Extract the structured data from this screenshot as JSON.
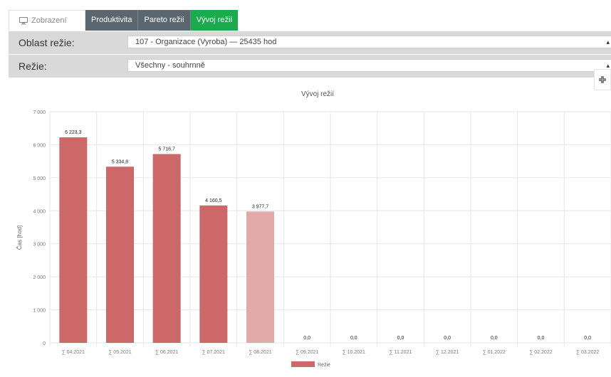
{
  "tabs": [
    {
      "label": "Zobrazení",
      "icon": "monitor-icon"
    },
    {
      "label": "Produktivita"
    },
    {
      "label": "Pareto režií"
    },
    {
      "label": "Vývoj režií"
    }
  ],
  "filters": {
    "oblast_label": "Oblast režie:",
    "oblast_value": "107 - Organizace (Vyroba) — 25435 hod",
    "rezie_label": "Režie:",
    "rezie_value": "Všechny - souhrnně"
  },
  "colors": {
    "bar": "#cd6868",
    "bar_light": "#e2a9a9",
    "tab_dark": "#5b6770",
    "tab_active": "#1aab4e"
  },
  "chart_data": {
    "type": "bar",
    "title": "Vývoj režií",
    "ylabel": "Čas [hod]",
    "xlabel": "",
    "ylim": [
      0,
      7000
    ],
    "yticks": [
      "0",
      "1 000",
      "2 000",
      "3 000",
      "4 000",
      "5 000",
      "6 000",
      "7 000"
    ],
    "categories": [
      "∑ 04.2021",
      "∑ 05.2021",
      "∑ 06.2021",
      "∑ 07.2021",
      "∑ 08.2021",
      "∑ 09.2021",
      "∑ 10.2021",
      "∑ 11.2021",
      "∑ 12.2021",
      "∑ 01.2022",
      "∑ 02.2022",
      "∑ 03.2022"
    ],
    "series": [
      {
        "name": "Režie",
        "values": [
          6223.3,
          5334.8,
          5716.7,
          4160.5,
          3977.7,
          0,
          0,
          0,
          0,
          0,
          0,
          0
        ],
        "labels": [
          "6 223,3",
          "5 334,8",
          "5 716,7",
          "4 160,5",
          "3 977,7",
          "0,0",
          "0,0",
          "0,0",
          "0,0",
          "0,0",
          "0,0",
          "0,0"
        ],
        "highlight_index": 4
      }
    ],
    "grid": true,
    "legend": "bottom-center"
  }
}
